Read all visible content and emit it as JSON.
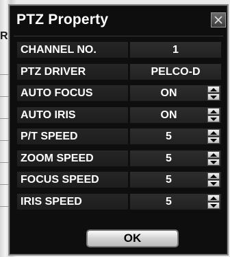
{
  "dialog": {
    "title": "PTZ Property",
    "ok_label": "OK"
  },
  "fields": [
    {
      "label": "CHANNEL NO.",
      "value": "1",
      "spinner": false
    },
    {
      "label": "PTZ DRIVER",
      "value": "PELCO-D",
      "spinner": false
    },
    {
      "label": "AUTO FOCUS",
      "value": "ON",
      "spinner": true
    },
    {
      "label": "AUTO IRIS",
      "value": "ON",
      "spinner": true
    },
    {
      "label": "P/T SPEED",
      "value": "5",
      "spinner": true
    },
    {
      "label": "ZOOM SPEED",
      "value": "5",
      "spinner": true
    },
    {
      "label": "FOCUS SPEED",
      "value": "5",
      "spinner": true
    },
    {
      "label": "IRIS SPEED",
      "value": "5",
      "spinner": true
    }
  ],
  "background": {
    "partial_text": "R"
  },
  "icons": {
    "close": "close-icon",
    "up": "arrow-up-icon",
    "down": "arrow-down-icon"
  }
}
